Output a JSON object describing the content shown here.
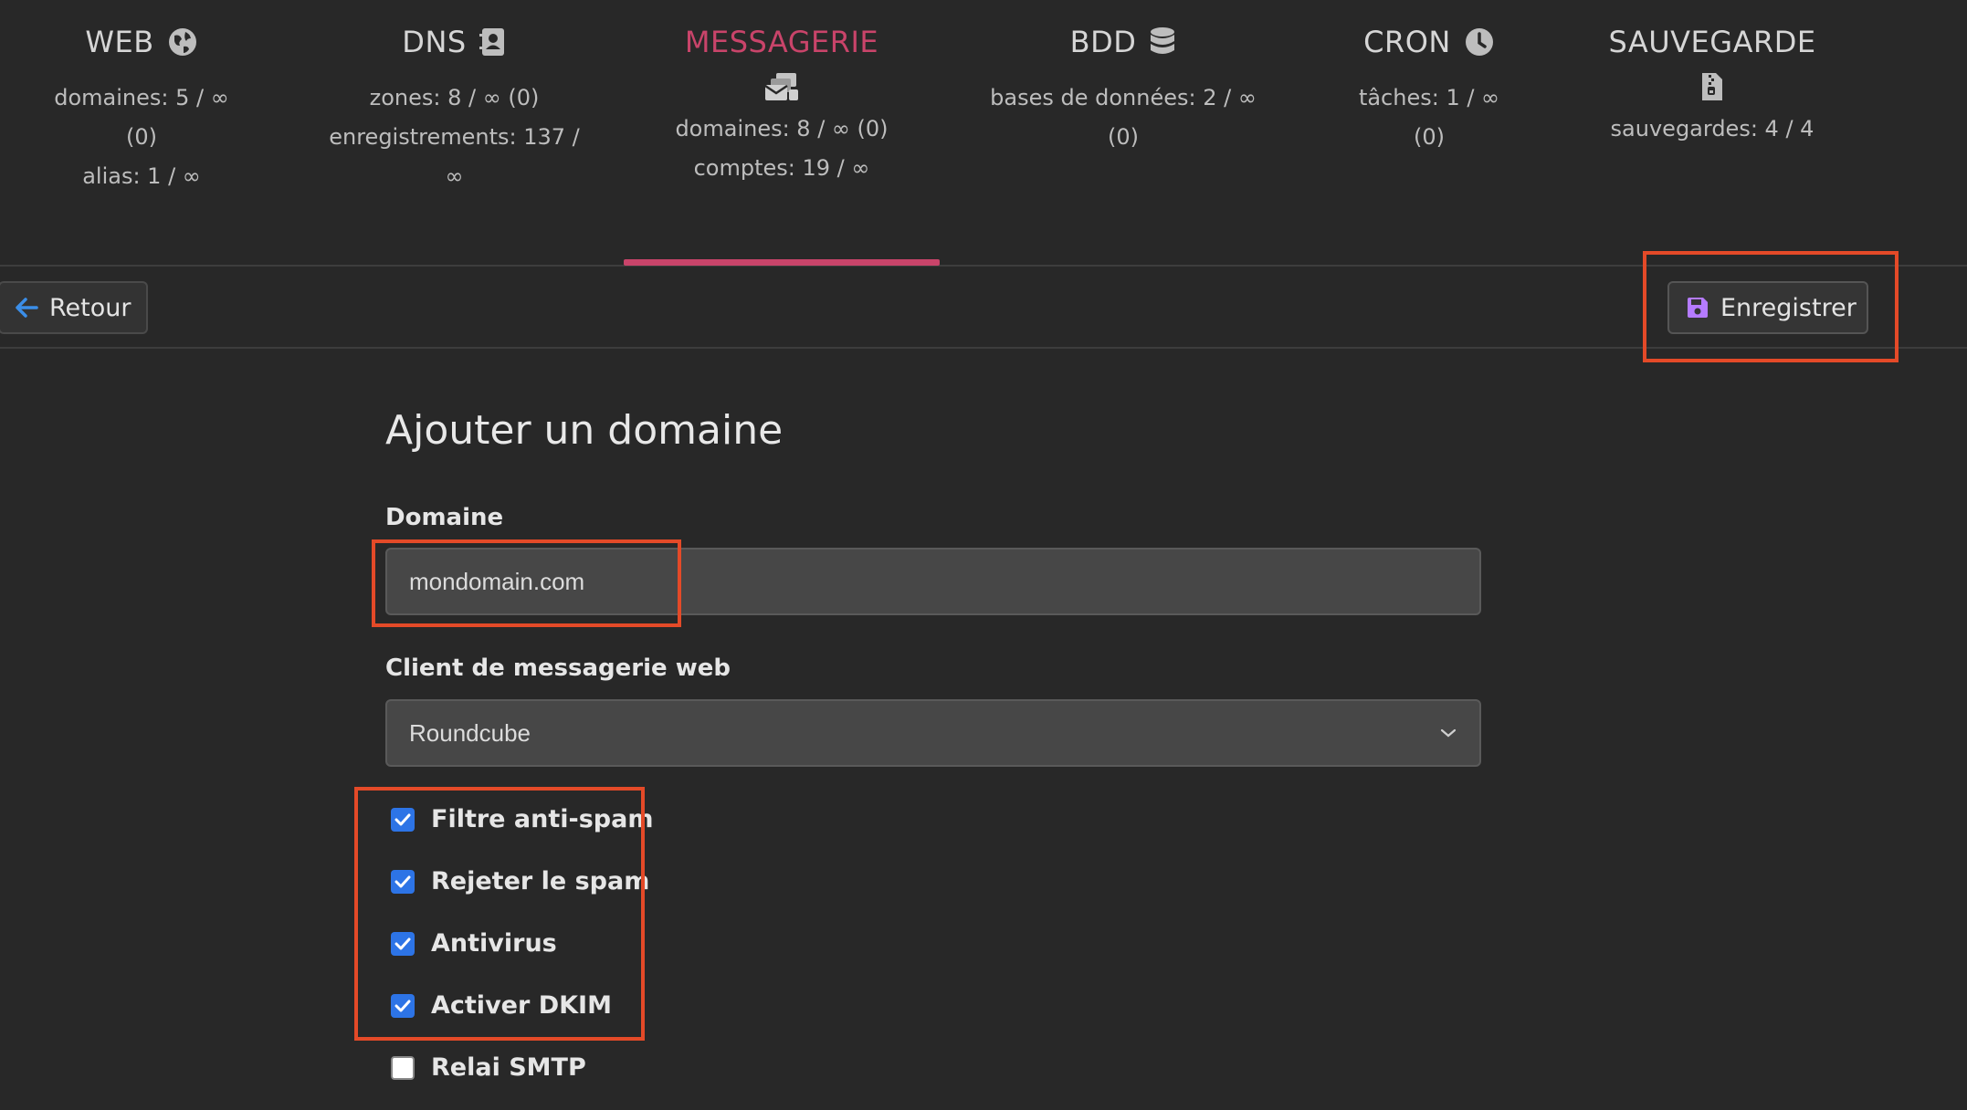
{
  "nav": {
    "tabs": [
      {
        "title": "WEB",
        "icon": "globe-icon",
        "stats": [
          "domaines: 5 / ∞",
          "(0)",
          "alias: 1 / ∞"
        ]
      },
      {
        "title": "DNS",
        "icon": "address-book-icon",
        "stats": [
          "zones: 8 / ∞ (0)",
          "enregistrements: 137 /",
          "∞"
        ]
      },
      {
        "title": "MESSAGERIE",
        "icon": "mail-bulk-icon",
        "stats": [
          "domaines: 8 / ∞ (0)",
          "comptes: 19 / ∞"
        ],
        "active": true
      },
      {
        "title": "BDD",
        "icon": "database-icon",
        "stats": [
          "bases de données: 2 / ∞",
          "(0)"
        ]
      },
      {
        "title": "CRON",
        "icon": "clock-icon",
        "stats": [
          "tâches: 1 / ∞",
          "(0)"
        ]
      },
      {
        "title": "SAUVEGARDE",
        "icon": "file-archive-icon",
        "stats": [
          "sauvegardes: 4 / 4"
        ]
      }
    ],
    "active_color": "#c9446a"
  },
  "toolbar": {
    "back_label": "Retour",
    "save_label": "Enregistrer",
    "save_icon_color": "#b57bff",
    "back_icon_color": "#3b8ee8"
  },
  "form": {
    "title": "Ajouter un domaine",
    "domain_label": "Domaine",
    "domain_value": "mondomain.com",
    "webmail_label": "Client de messagerie web",
    "webmail_value": "Roundcube",
    "checkboxes": [
      {
        "label": "Filtre anti-spam",
        "checked": true
      },
      {
        "label": "Rejeter le spam",
        "checked": true
      },
      {
        "label": "Antivirus",
        "checked": true
      },
      {
        "label": "Activer DKIM",
        "checked": true
      },
      {
        "label": "Relai SMTP",
        "checked": false
      }
    ]
  },
  "highlight_color": "#e44a28"
}
